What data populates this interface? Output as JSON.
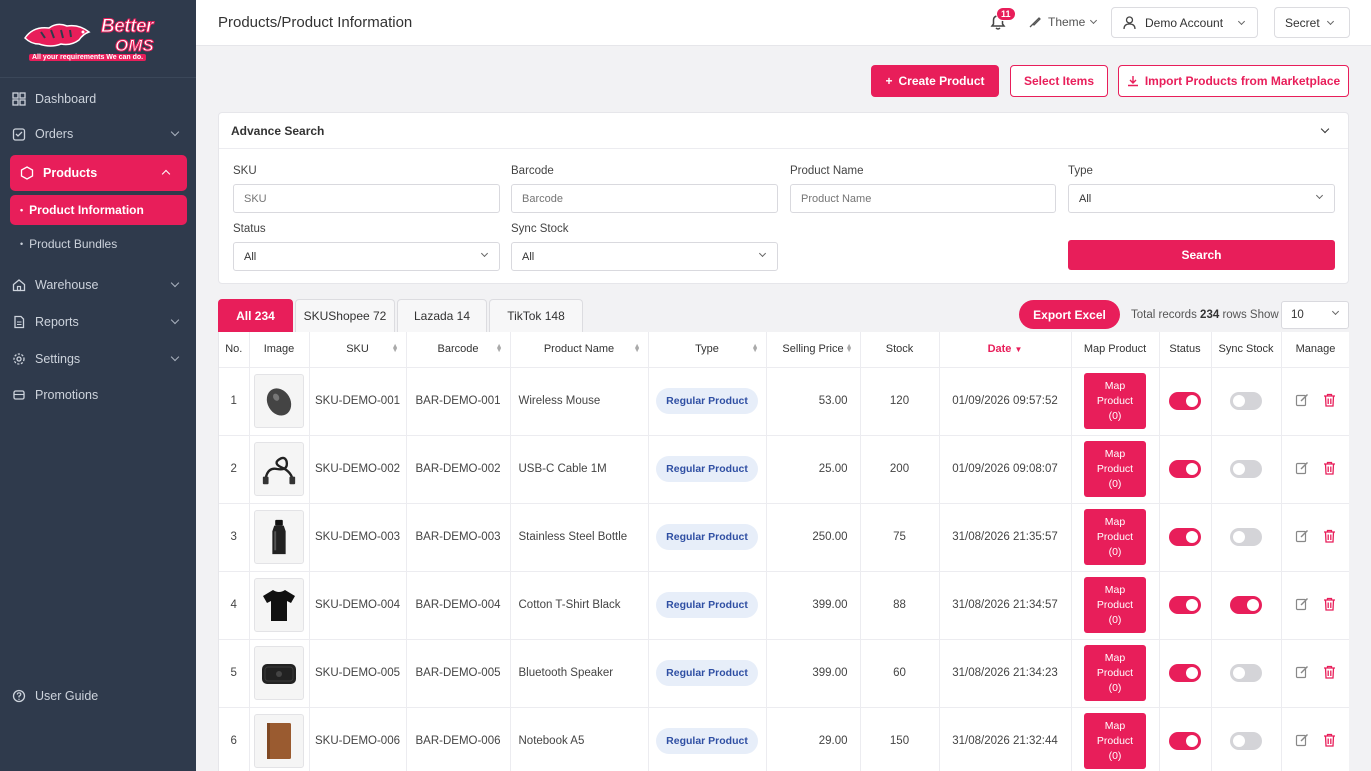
{
  "brand": {
    "name_top": "Better",
    "name_bottom": "OMS",
    "tagline": "All your requirements We can do."
  },
  "sidebar": {
    "items": [
      {
        "label": "Dashboard"
      },
      {
        "label": "Orders"
      },
      {
        "label": "Products"
      },
      {
        "label": "Product Information"
      },
      {
        "label": "Product Bundles"
      },
      {
        "label": "Warehouse"
      },
      {
        "label": "Reports"
      },
      {
        "label": "Settings"
      },
      {
        "label": "Promotions"
      }
    ],
    "user_guide": "User Guide"
  },
  "header": {
    "title": "Products/Product Information",
    "notification_count": "11",
    "theme_label": "Theme",
    "account_label": "Demo Account",
    "secret_label": "Secret"
  },
  "actions": {
    "create": "Create Product",
    "select": "Select Items",
    "import": "Import Products from Marketplace"
  },
  "search": {
    "title": "Advance Search",
    "sku_label": "SKU",
    "sku_placeholder": "SKU",
    "barcode_label": "Barcode",
    "barcode_placeholder": "Barcode",
    "name_label": "Product Name",
    "name_placeholder": "Product Name",
    "type_label": "Type",
    "type_value": "All",
    "status_label": "Status",
    "status_value": "All",
    "sync_label": "Sync Stock",
    "sync_value": "All",
    "button": "Search"
  },
  "tabs": [
    {
      "label": "All 234"
    },
    {
      "label": "SKUShopee 72"
    },
    {
      "label": "Lazada 14"
    },
    {
      "label": "TikTok 148"
    }
  ],
  "toolbar": {
    "export": "Export Excel",
    "records_prefix": "Total records",
    "records_count": "234",
    "records_suffix": "rows  Show",
    "page_size": "10"
  },
  "table": {
    "columns": [
      "No.",
      "Image",
      "SKU",
      "Barcode",
      "Product Name",
      "Type",
      "Selling Price",
      "Stock",
      "Date",
      "Map Product",
      "Status",
      "Sync Stock",
      "Manage"
    ],
    "map_line1": "Map",
    "map_line2": "Product",
    "map_line3": "(0)",
    "rows": [
      {
        "no": "1",
        "image": "mouse-icon",
        "sku": "SKU-DEMO-001",
        "barcode": "BAR-DEMO-001",
        "name": "Wireless Mouse",
        "type": "Regular Product",
        "price": "53.00",
        "stock": "120",
        "date": "01/09/2026 09:57:52",
        "status": true,
        "sync": false
      },
      {
        "no": "2",
        "image": "cable-icon",
        "sku": "SKU-DEMO-002",
        "barcode": "BAR-DEMO-002",
        "name": "USB-C Cable 1M",
        "type": "Regular Product",
        "price": "25.00",
        "stock": "200",
        "date": "01/09/2026 09:08:07",
        "status": true,
        "sync": false
      },
      {
        "no": "3",
        "image": "bottle-icon",
        "sku": "SKU-DEMO-003",
        "barcode": "BAR-DEMO-003",
        "name": "Stainless Steel Bottle",
        "type": "Regular Product",
        "price": "250.00",
        "stock": "75",
        "date": "31/08/2026 21:35:57",
        "status": true,
        "sync": false
      },
      {
        "no": "4",
        "image": "tshirt-icon",
        "sku": "SKU-DEMO-004",
        "barcode": "BAR-DEMO-004",
        "name": "Cotton T-Shirt Black",
        "type": "Regular Product",
        "price": "399.00",
        "stock": "88",
        "date": "31/08/2026 21:34:57",
        "status": true,
        "sync": true
      },
      {
        "no": "5",
        "image": "speaker-icon",
        "sku": "SKU-DEMO-005",
        "barcode": "BAR-DEMO-005",
        "name": "Bluetooth Speaker",
        "type": "Regular Product",
        "price": "399.00",
        "stock": "60",
        "date": "31/08/2026 21:34:23",
        "status": true,
        "sync": false
      },
      {
        "no": "6",
        "image": "notebook-icon",
        "sku": "SKU-DEMO-006",
        "barcode": "BAR-DEMO-006",
        "name": "Notebook A5",
        "type": "Regular Product",
        "price": "29.00",
        "stock": "150",
        "date": "31/08/2026 21:32:44",
        "status": true,
        "sync": false
      }
    ]
  },
  "colors": {
    "accent": "#e81e5a",
    "sidebar_bg": "#2f3a4c"
  }
}
